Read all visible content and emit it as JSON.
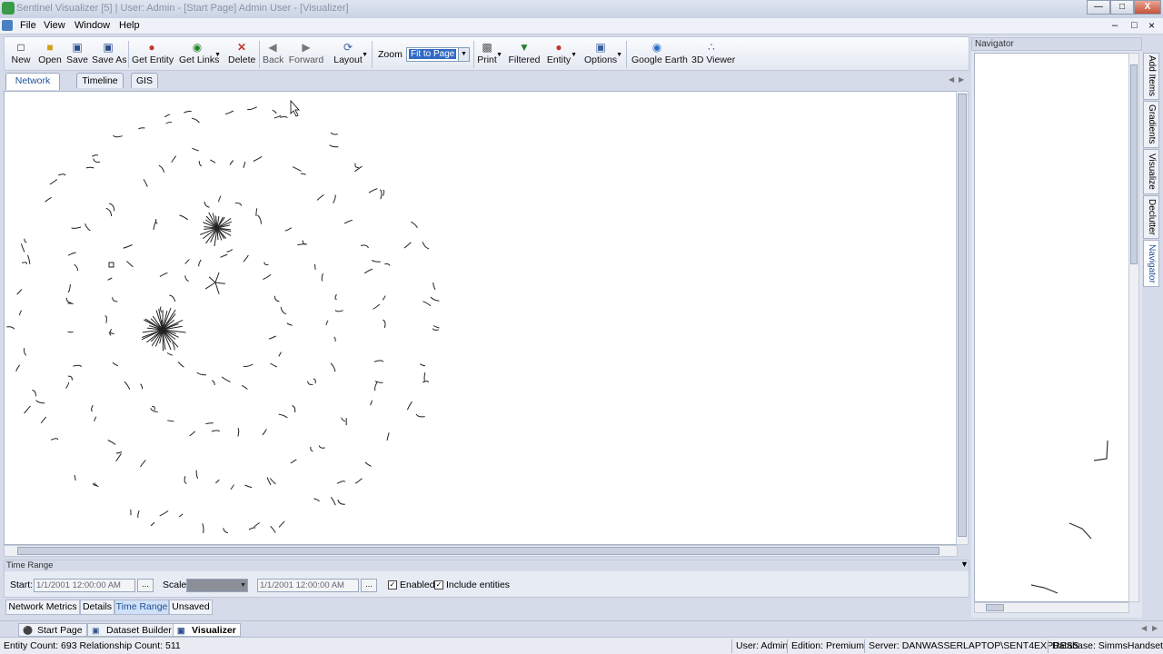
{
  "window": {
    "title": "Sentinel Visualizer [5] | User: Admin - [Start Page] Admin User - [Visualizer]",
    "controls": {
      "minimize": "—",
      "maximize": "□",
      "close": "X"
    },
    "mdi_controls": {
      "minimize": "–",
      "restore": "□",
      "close": "×"
    }
  },
  "menu": {
    "items": [
      "File",
      "View",
      "Window",
      "Help"
    ]
  },
  "toolbar": {
    "new": "New",
    "open": "Open",
    "save": "Save",
    "save_as": "Save As",
    "get_entity": "Get Entity",
    "get_links": "Get Links",
    "delete": "Delete",
    "back": "Back",
    "forward": "Forward",
    "layout": "Layout",
    "zoom_label": "Zoom",
    "zoom_value": "Fit to Page",
    "print": "Print",
    "filtered": "Filtered",
    "entity": "Entity",
    "options": "Options",
    "google_earth": "Google Earth",
    "viewer_3d": "3D Viewer"
  },
  "view_tabs": {
    "network": "Network",
    "timeline": "Timeline",
    "gis": "GIS",
    "active": "Network"
  },
  "time_range": {
    "header": "Time Range",
    "start_label": "Start:",
    "start_value": "1/1/2001 12:00:00 AM",
    "scale_label": "Scale:",
    "end_value": "1/1/2001 12:00:00 AM",
    "ellipsis": "...",
    "enabled_label": "Enabled",
    "include_entities_label": "Include entities"
  },
  "bottom_tabs": {
    "network_metrics": "Network Metrics",
    "details": "Details",
    "time_range": "Time Range",
    "unsaved": "Unsaved",
    "active": "Time Range"
  },
  "document_tabs": {
    "start_page": "Start Page",
    "dataset_builder": "Dataset Builder",
    "visualizer": "Visualizer",
    "active": "Visualizer"
  },
  "status": {
    "counts": "Entity Count: 693  Relationship Count: 511",
    "user": "User: Admin",
    "edition": "Edition: Premium",
    "server": "Server: DANWASSERLAPTOP\\SENT4EXPRESS",
    "database": "Database: SimmsHandsets"
  },
  "navigator": {
    "title": "Navigator"
  },
  "side_tabs": {
    "add_items": "Add Items",
    "gradients": "Gradients",
    "visualize": "Visualize",
    "declutter": "Declutter",
    "navigator": "Navigator",
    "active": "Navigator"
  },
  "colors": {
    "accent": "#1f4f99",
    "selection": "#316ac5",
    "chrome": "#d6dbe9"
  },
  "network_graph": {
    "hubs": [
      {
        "name": "hub-a",
        "degree": 26
      },
      {
        "name": "hub-b",
        "degree": 34
      },
      {
        "name": "hub-c",
        "degree": 5
      }
    ],
    "ring_pairs": [
      26,
      40,
      56,
      72
    ]
  }
}
